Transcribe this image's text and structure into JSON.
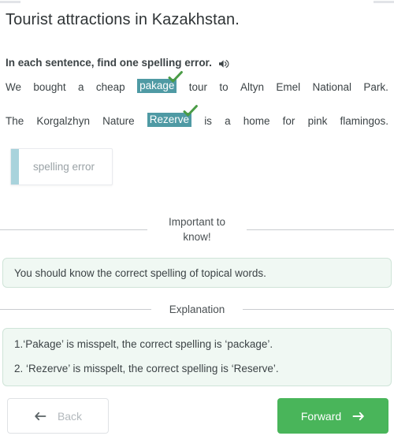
{
  "page": {
    "title": "Tourist attractions in Kazakhstan."
  },
  "instruction": {
    "text": "In each sentence, find one spelling error.",
    "audio_icon": "speaker-icon"
  },
  "sentences": [
    {
      "id": "sentence-1",
      "before": [
        "We",
        "bought",
        "a",
        "cheap"
      ],
      "answer": "pakage",
      "after": [
        "tour",
        "to",
        "Altyn",
        "Emel",
        "National",
        "Park."
      ],
      "status_icon": "check-icon"
    },
    {
      "id": "sentence-2",
      "before": [
        "The",
        "Korgalzhyn",
        "Nature"
      ],
      "answer": "Rezerve",
      "after": [
        "is",
        "a",
        "home",
        "for",
        "pink",
        "flamingos."
      ],
      "status_icon": "check-icon"
    }
  ],
  "token": {
    "label": "spelling error"
  },
  "important": {
    "divider_label": "Important to know!",
    "body": "You should know the correct spelling of topical words."
  },
  "explanation": {
    "divider_label": "Explanation",
    "lines": [
      "1.‘Pakage’ is misspelt, the correct spelling is ‘package’.",
      "2. ‘Rezerve’ is misspelt, the correct spelling is ‘Reserve’."
    ]
  },
  "footer": {
    "back_label": "Back",
    "back_icon": "arrow-left-icon",
    "forward_label": "Forward",
    "forward_icon": "arrow-right-icon"
  },
  "colors": {
    "highlight_teal": "#4f9aa4",
    "check_green": "#4a9c46",
    "forward_green": "#49b55a",
    "chip_bar_blue": "#a9d3dc",
    "info_bg": "#f0f8f3",
    "info_border": "#cfe4d8"
  }
}
